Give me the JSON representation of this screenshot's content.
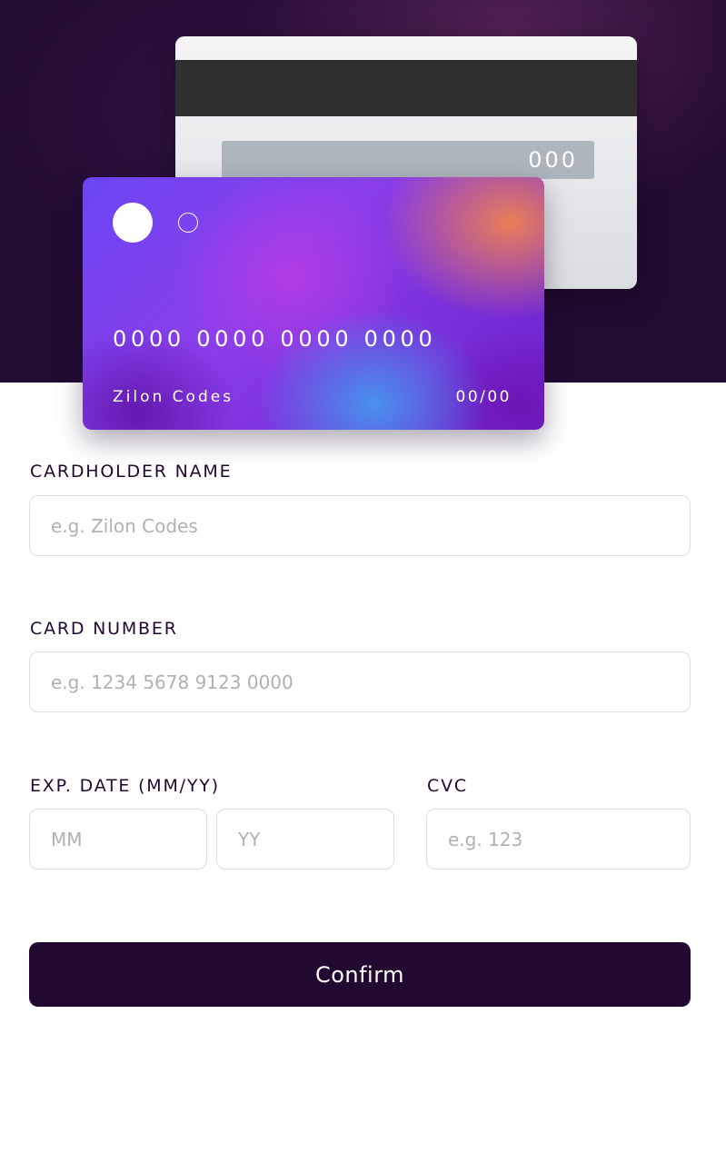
{
  "card_back": {
    "cvc": "000"
  },
  "card_front": {
    "number": "0000 0000 0000 0000",
    "holder": "Zilon Codes",
    "expiry": "00/00"
  },
  "form": {
    "name_label": "CARDHOLDER NAME",
    "name_placeholder": "e.g. Zilon Codes",
    "number_label": "CARD NUMBER",
    "number_placeholder": "e.g. 1234 5678 9123 0000",
    "exp_label": "EXP. DATE (MM/YY)",
    "mm_placeholder": "MM",
    "yy_placeholder": "YY",
    "cvc_label": "CVC",
    "cvc_placeholder": "e.g. 123",
    "confirm_label": "Confirm"
  },
  "colors": {
    "background_dark": "#230c33",
    "button": "#21092f",
    "border": "#dedddf",
    "placeholder": "#b2afb6"
  }
}
